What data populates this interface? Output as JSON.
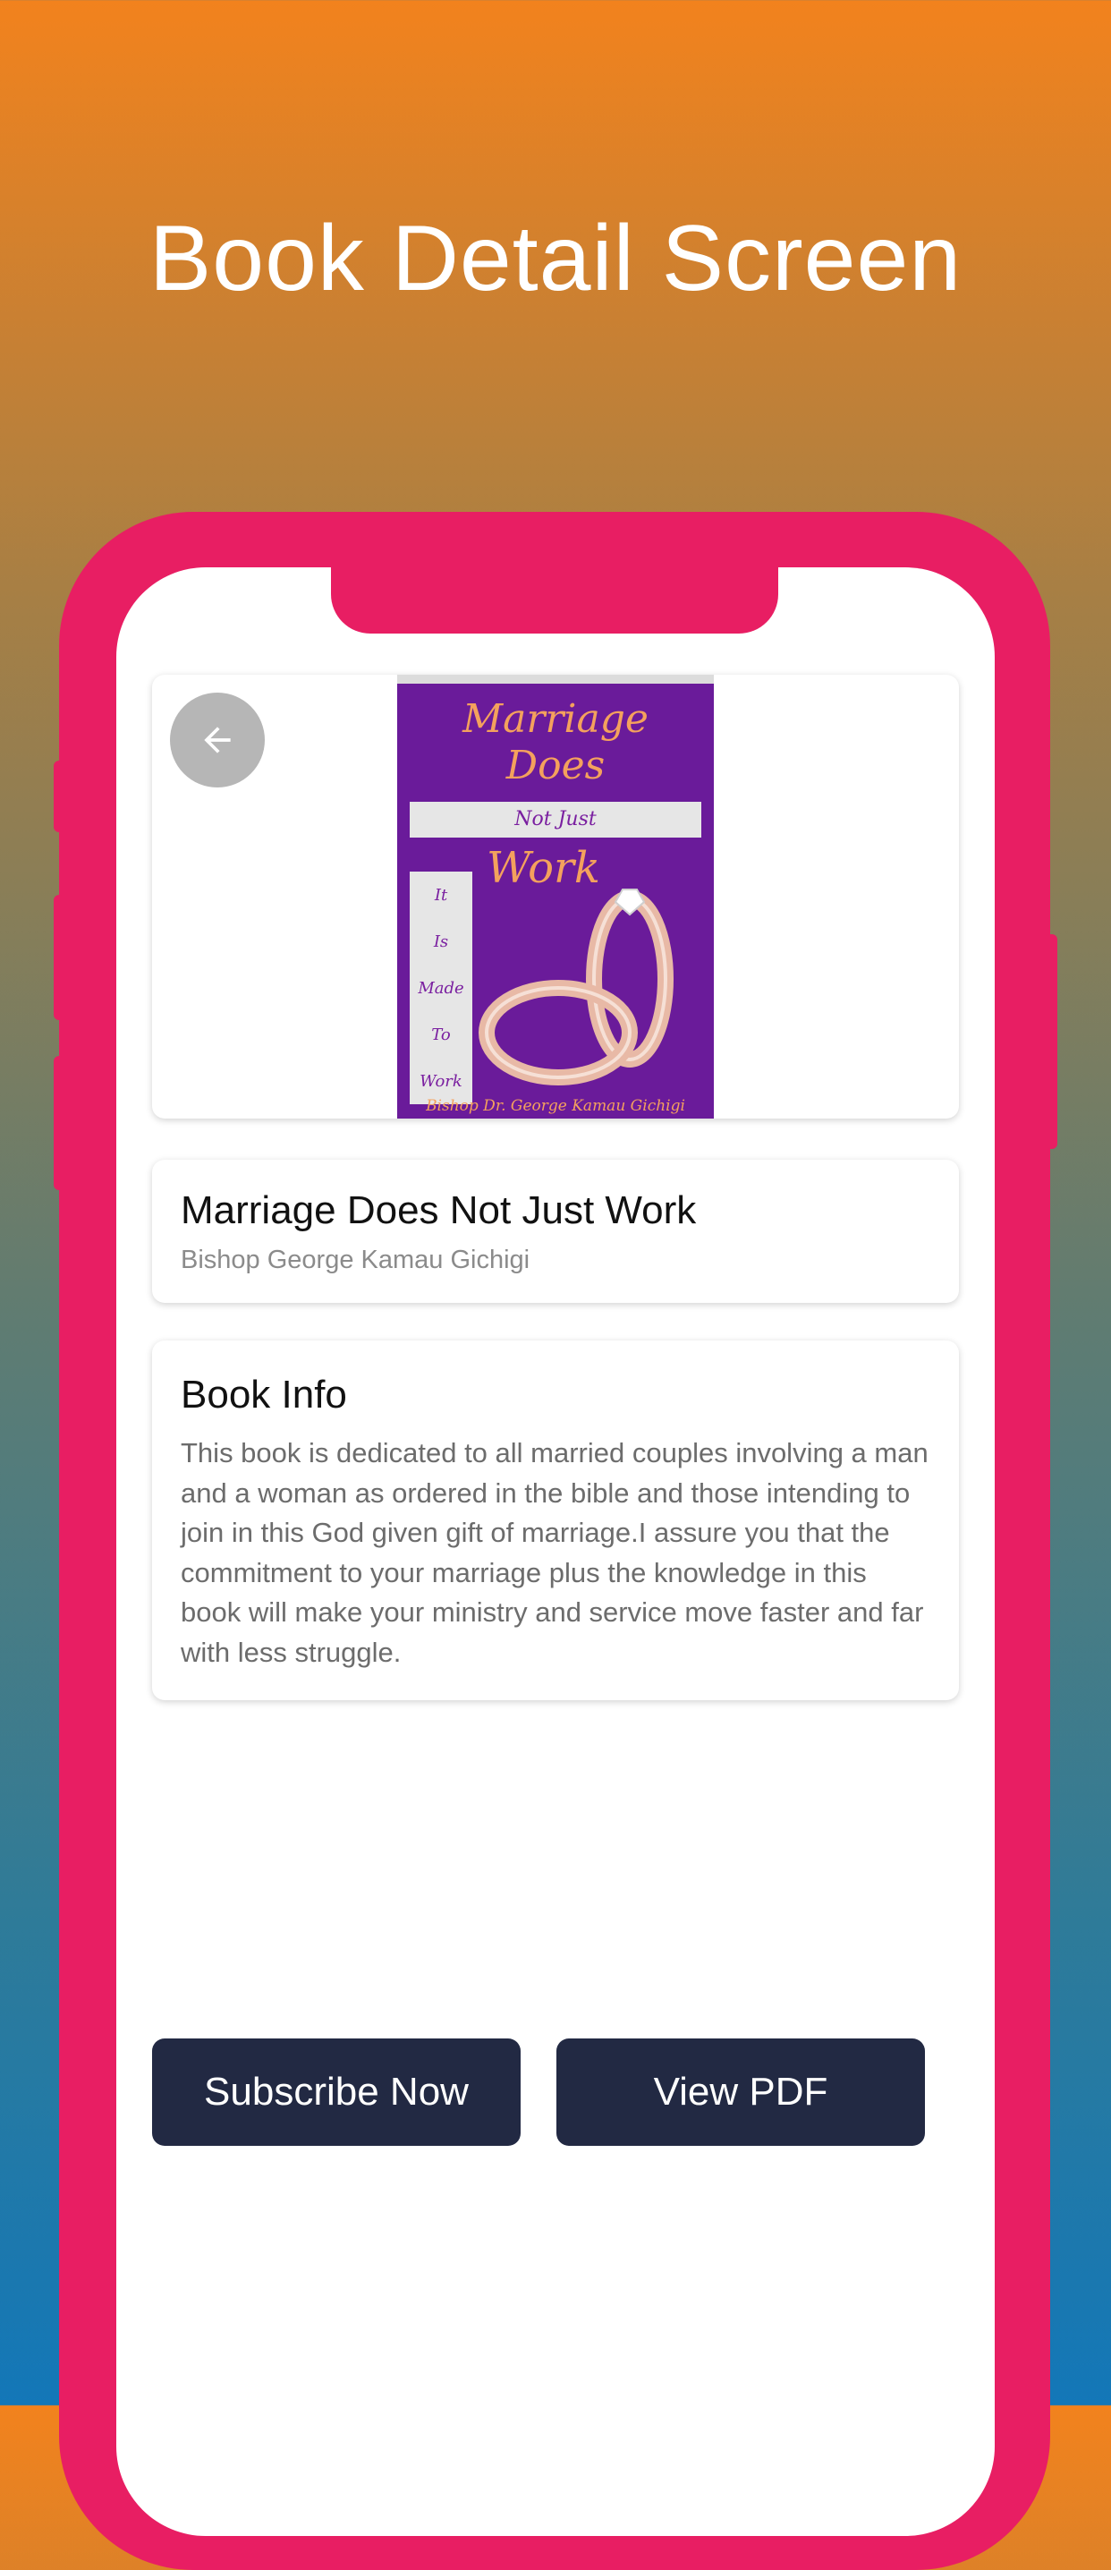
{
  "headline": "Book Detail Screen",
  "colors": {
    "frame": "#e81e63",
    "button_bg": "#222943",
    "gradient_top": "#f2821d",
    "gradient_bottom": "#1377b8"
  },
  "cover": {
    "title_line1": "Marriage",
    "title_line2": "Does",
    "band": "Not Just",
    "word": "Work",
    "side": [
      "It",
      "Is",
      "Made",
      "To",
      "Work"
    ],
    "author": "Bishop Dr. George Kamau Gichigi"
  },
  "book": {
    "title": "Marriage Does Not Just Work",
    "author": "Bishop George Kamau Gichigi"
  },
  "info": {
    "heading": "Book Info",
    "description": "This book is dedicated to all married couples involving a man and a woman as ordered in the bible and those intending to join in this God given gift of marriage.I assure you that the commitment to your marriage plus the knowledge in this book will make your ministry and service move faster and far with less struggle."
  },
  "actions": {
    "subscribe": "Subscribe Now",
    "view_pdf": "View PDF"
  },
  "icons": {
    "back": "arrow-left-icon"
  }
}
